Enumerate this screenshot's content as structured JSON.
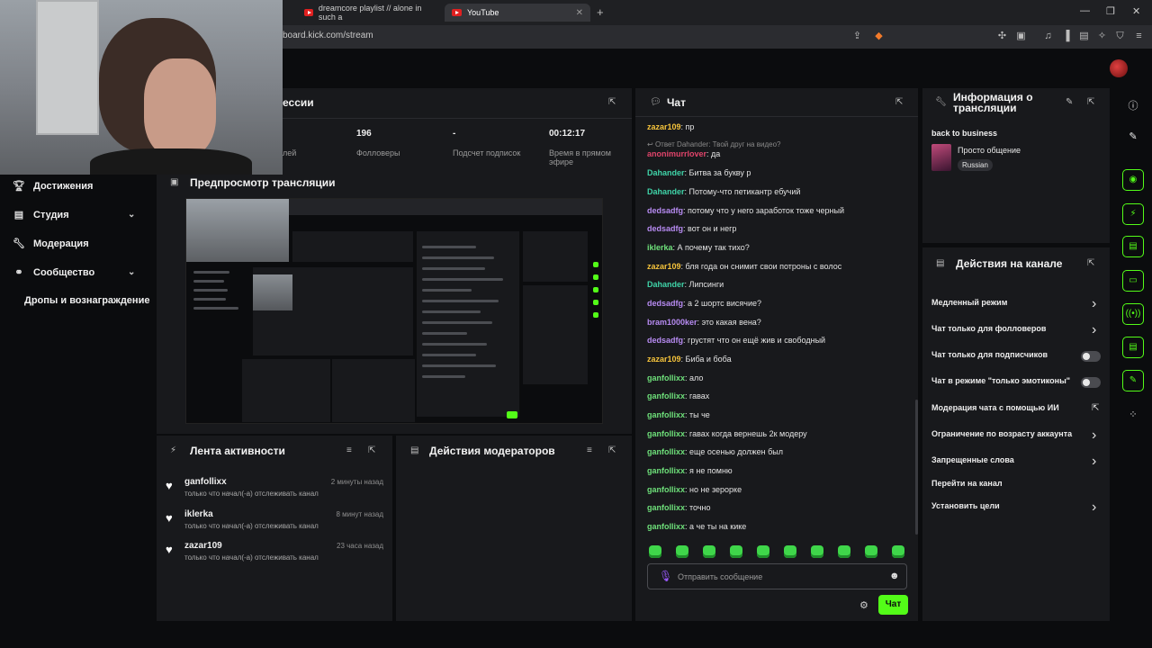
{
  "browser": {
    "tabs": [
      {
        "label": "dreamcore playlist // alone in such a"
      },
      {
        "label": "YouTube"
      }
    ],
    "url": "board.kick.com/stream"
  },
  "sidebar": {
    "items": [
      {
        "label": "Достижения",
        "icon": "trophy-icon"
      },
      {
        "label": "Студия",
        "icon": "studio-icon"
      },
      {
        "label": "Модерация",
        "icon": "wrench-icon"
      },
      {
        "label": "Сообщество",
        "icon": "community-icon"
      },
      {
        "label": "Дропы и вознаграждение",
        "icon": ""
      }
    ]
  },
  "session": {
    "title": "ессии",
    "stats": [
      {
        "value": "",
        "label": "лей"
      },
      {
        "value": "196",
        "label": "Фолловеры"
      },
      {
        "value": "-",
        "label": "Подсчет подписок"
      },
      {
        "value": "00:12:17",
        "label": "Время в прямом эфире"
      }
    ]
  },
  "preview": {
    "title": "Предпросмотр трансляции"
  },
  "activity": {
    "title": "Лента активности",
    "rows": [
      {
        "name": "ganfollixx",
        "text": "только что начал(-а) отслеживать канал",
        "time": "2 минуты назад"
      },
      {
        "name": "iklerka",
        "text": "только что начал(-а) отслеживать канал",
        "time": "8 минут назад"
      },
      {
        "name": "zazar109",
        "text": "только что начал(-а) отслеживать канал",
        "time": "23 часа назад"
      }
    ]
  },
  "modactions": {
    "title": "Действия модераторов"
  },
  "chat": {
    "title": "Чат",
    "reply": "Ответ Dahander: Твой друг на видео?",
    "messages": [
      {
        "user": "zazar109",
        "color": "#f5c33b",
        "text": "пр"
      },
      {
        "user": "anonimurrlover",
        "color": "#e0446a",
        "text": "да"
      },
      {
        "user": "Dahander",
        "color": "#3fd3a8",
        "text": "Битва за букву р"
      },
      {
        "user": "Dahander",
        "color": "#3fd3a8",
        "text": "Потому-что петикантр ебучий"
      },
      {
        "user": "dedsadfg",
        "color": "#b78bf2",
        "text": "потому что у него заработок тоже черный"
      },
      {
        "user": "dedsadfg",
        "color": "#b78bf2",
        "text": "вот он и негр"
      },
      {
        "user": "iklerka",
        "color": "#6ee07a",
        "text": "А почему так тихо?"
      },
      {
        "user": "zazar109",
        "color": "#f5c33b",
        "text": "бля года он снимит свои потроны с волос"
      },
      {
        "user": "Dahander",
        "color": "#3fd3a8",
        "text": "Липсинги"
      },
      {
        "user": "dedsadfg",
        "color": "#b78bf2",
        "text": "а 2 шортс висячие?"
      },
      {
        "user": "bram1000ker",
        "color": "#b78bf2",
        "text": "это какая вена?"
      },
      {
        "user": "dedsadfg",
        "color": "#b78bf2",
        "text": "грустят что он ещё жив и свободный"
      },
      {
        "user": "zazar109",
        "color": "#f5c33b",
        "text": "Биба и боба"
      },
      {
        "user": "ganfollixx",
        "color": "#6ee07a",
        "text": "ало"
      },
      {
        "user": "ganfollixx",
        "color": "#6ee07a",
        "text": "гавах"
      },
      {
        "user": "ganfollixx",
        "color": "#6ee07a",
        "text": "ты че"
      },
      {
        "user": "ganfollixx",
        "color": "#6ee07a",
        "text": "гавах когда вернешь 2к модеру"
      },
      {
        "user": "ganfollixx",
        "color": "#6ee07a",
        "text": "еще осенью должен был"
      },
      {
        "user": "ganfollixx",
        "color": "#6ee07a",
        "text": "я не помню"
      },
      {
        "user": "ganfollixx",
        "color": "#6ee07a",
        "text": "но не зерорке"
      },
      {
        "user": "ganfollixx",
        "color": "#6ee07a",
        "text": "точно"
      },
      {
        "user": "ganfollixx",
        "color": "#6ee07a",
        "text": "а че ты на кике"
      }
    ],
    "input_placeholder": "Отправить сообщение",
    "send_label": "Чат"
  },
  "stream_info": {
    "title_line1": "Информация о",
    "title_line2": "трансляции",
    "stream_title": "back to business",
    "category": "Просто общение",
    "language": "Russian"
  },
  "channel_actions": {
    "title": "Действия на канале",
    "items": [
      {
        "label": "Медленный режим",
        "control": "chevron"
      },
      {
        "label": "Чат только для фолловеров",
        "control": "chevron"
      },
      {
        "label": "Чат только для подписчиков",
        "control": "toggle"
      },
      {
        "label": "Чат в режиме \"только эмотиконы\"",
        "control": "toggle"
      },
      {
        "label": "Модерация чата с помощью ИИ",
        "control": "external"
      },
      {
        "label": "Ограничение по возрасту аккаунта",
        "control": "chevron"
      },
      {
        "label": "Запрещенные слова",
        "control": "chevron"
      },
      {
        "label": "Перейти на канал",
        "control": "none"
      },
      {
        "label": "Установить цели",
        "control": "chevron"
      }
    ]
  },
  "colors": {
    "accent": "#53fc18",
    "panel": "#18191c",
    "background": "#0b0c0e"
  }
}
